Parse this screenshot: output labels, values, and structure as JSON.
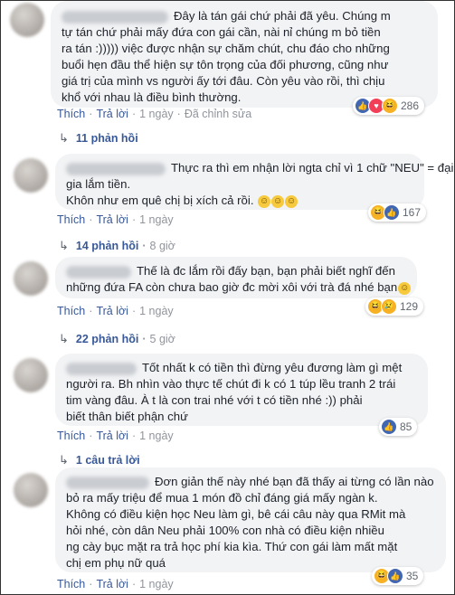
{
  "comments": [
    {
      "lines": [
        "Đây là tán gái chứ phải đã yêu. Chúng m",
        "tự tán chứ phải mấy đứa con gái cần, nài nỉ chúng m bỏ tiền",
        "ra tán :)))))  việc được nhận sự chăm chút, chu đáo cho những",
        "buổi hẹn đầu thể hiện sự tôn trọng của đối phương, cũng như",
        "giá trị của mình vs người ấy tới đâu. Còn yêu vào rồi, thì chịu",
        "khổ với nhau là điều bình thường."
      ],
      "actions": {
        "like": "Thích",
        "reply": "Trả lời",
        "time": "1 ngày",
        "edited": "Đã chỉnh sửa"
      },
      "reactions": {
        "icons": [
          "like-icon",
          "love-icon",
          "haha-icon"
        ],
        "count": "286"
      },
      "replies": {
        "label": "11 phản hồi",
        "time": ""
      }
    },
    {
      "lines": [
        "Thực ra thì em nhận lời ngta chỉ vì 1 chữ \"NEU\" = đại",
        "gia lắm tiền.",
        "Khôn như em quê chị bị xích cả rồi."
      ],
      "actions": {
        "like": "Thích",
        "reply": "Trả lời",
        "time": "1 ngày",
        "edited": ""
      },
      "reactions": {
        "icons": [
          "haha-icon",
          "like-icon"
        ],
        "count": "167"
      },
      "replies": {
        "label": "14 phản hồi",
        "time": "8 giờ"
      }
    },
    {
      "lines": [
        "Thế là đc lắm rồi đấy bạn, bạn phải biết nghĩ đến",
        "những đứa FA còn chưa bao giờ đc mời xôi với trà đá nhé bạn"
      ],
      "actions": {
        "like": "Thích",
        "reply": "Trả lời",
        "time": "1 ngày",
        "edited": ""
      },
      "reactions": {
        "icons": [
          "haha-icon",
          "sad-icon"
        ],
        "count": "129"
      },
      "replies": {
        "label": "22 phản hồi",
        "time": "5 giờ"
      }
    },
    {
      "lines": [
        "Tốt nhất k có tiền thì đừng yêu đương làm gì mệt",
        "người ra. Bh nhìn vào thực tế chút đi k có 1 túp lều tranh 2 trái",
        "tim vàng đâu. À t là con trai nhé với t có tiền nhé :)) phải",
        "biết thân biết phận chứ"
      ],
      "actions": {
        "like": "Thích",
        "reply": "Trả lời",
        "time": "1 ngày",
        "edited": ""
      },
      "reactions": {
        "icons": [
          "like-icon"
        ],
        "count": "85"
      },
      "replies": {
        "label": "1 câu trả lời",
        "time": ""
      }
    },
    {
      "lines": [
        "Đơn giản thế này nhé bạn đã thấy ai từng có lần nào",
        "bỏ ra mấy triệu để mua 1 món đồ chỉ đáng giá mấy ngàn k.",
        "Không có điều kiện học Neu làm gì, bê cái câu này qua RMit mà",
        "hỏi nhé, còn dân Neu phải 100% con nhà có điều kiện nhiều",
        "ng cày bục mặt ra trả học phí kia kìa. Thứ con gái làm mất mặt",
        "chị em phụ nữ quá"
      ],
      "actions": {
        "like": "Thích",
        "reply": "Trả lời",
        "time": "1 ngày",
        "edited": ""
      },
      "reactions": {
        "icons": [
          "haha-icon",
          "like-icon"
        ],
        "count": "35"
      },
      "replies": {
        "label": "",
        "time": ""
      }
    }
  ]
}
